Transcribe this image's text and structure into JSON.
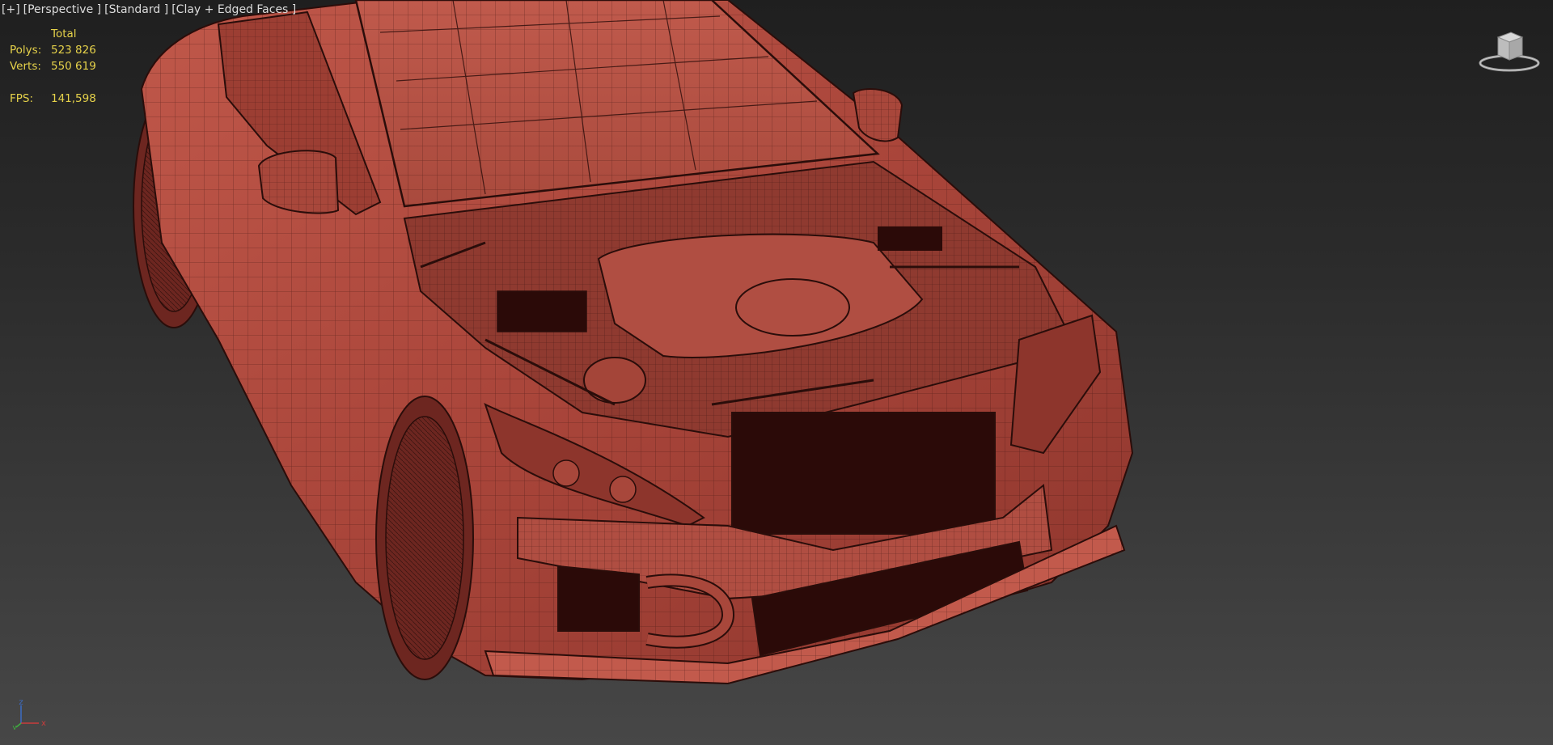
{
  "viewport": {
    "label_parts": [
      "[+]",
      "[Perspective ]",
      "[Standard ]",
      "[Clay + Edged Faces ]"
    ],
    "background": "#2b2b2b"
  },
  "stats": {
    "header": "Total",
    "polys_label": "Polys:",
    "polys_value": "523 826",
    "verts_label": "Verts:",
    "verts_value": "550 619",
    "fps_label": "FPS:",
    "fps_value": "141,598",
    "color": "#e6d24a"
  },
  "model": {
    "clay_color": "#b5483c",
    "edge_color": "#2a0d0a"
  },
  "axis": {
    "x_label": "x",
    "y_label": "y",
    "z_label": "z"
  },
  "icons": {
    "viewcube": "viewcube-icon",
    "axis_tripod": "axis-tripod-icon"
  }
}
